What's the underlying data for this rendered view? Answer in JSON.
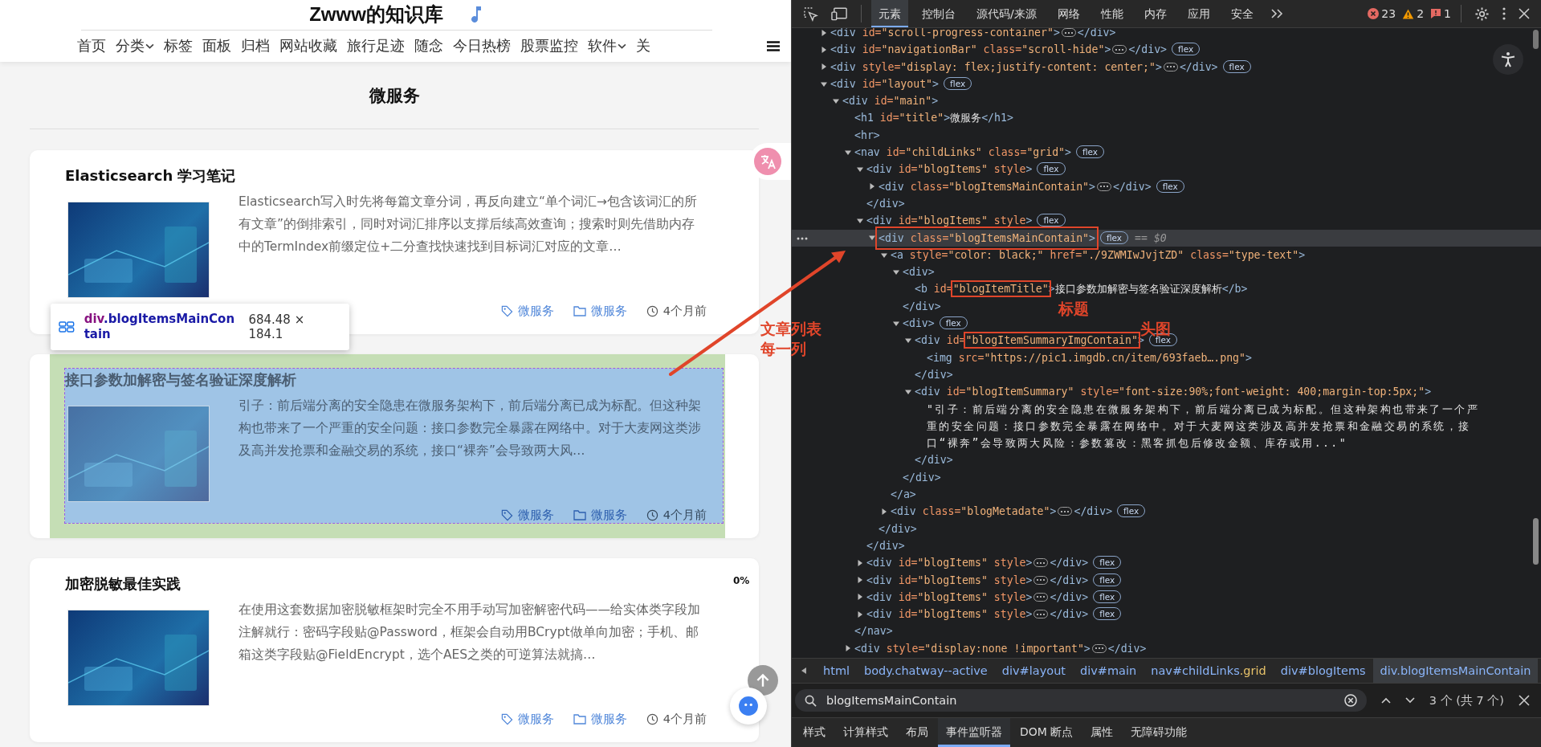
{
  "page": {
    "site_title": "Zwww的知识库",
    "nav": [
      {
        "label": "首页",
        "has_menu": false
      },
      {
        "label": "分类",
        "has_menu": true
      },
      {
        "label": "标签",
        "has_menu": false
      },
      {
        "label": "面板",
        "has_menu": false
      },
      {
        "label": "归档",
        "has_menu": false
      },
      {
        "label": "网站收藏",
        "has_menu": false
      },
      {
        "label": "旅行足迹",
        "has_menu": false
      },
      {
        "label": "随念",
        "has_menu": false
      },
      {
        "label": "今日热榜",
        "has_menu": false
      },
      {
        "label": "股票监控",
        "has_menu": false
      },
      {
        "label": "软件",
        "has_menu": true
      },
      {
        "label": "关",
        "has_menu": false
      }
    ],
    "heading": "微服务",
    "posts": [
      {
        "title": "Elasticsearch 学习笔记",
        "summary": "Elasticsearch写入时先将每篇文章分词，再反向建立“单个词汇→包含该词汇的所有文章”的倒排索引，同时对词汇排序以支撑后续高效查询；搜索时则先借助内存中的TermIndex前缀定位+二分查找快速找到目标词汇对应的文章…",
        "tag": "微服务",
        "category": "微服务",
        "time": "4个月前",
        "inspected": false
      },
      {
        "title": "接口参数加解密与签名验证深度解析",
        "summary": "引子：前后端分离的安全隐患在微服务架构下，前后端分离已成为标配。但这种架构也带来了一个严重的安全问题：接口参数完全暴露在网络中。对于大麦网这类涉及高并发抢票和金融交易的系统，接口“裸奔”会导致两大风…",
        "tag": "微服务",
        "category": "微服务",
        "time": "4个月前",
        "inspected": true
      },
      {
        "title": "加密脱敏最佳实践",
        "summary": "在使用这套数据加密脱敏框架时完全不用手动写加密解密代码——给实体类字段加注解就行：密码字段贴@Password，框架会自动用BCrypt做单向加密；手机、邮箱这类字段贴@FieldEncrypt，选个AES之类的可逆算法就搞…",
        "tag": "微服务",
        "category": "微服务",
        "time": "4个月前",
        "inspected": false
      }
    ],
    "inspect_tooltip": {
      "selector": "div.blogItemsMainContain",
      "size": "684.48 × 184.1"
    },
    "scroll_progress": "0%"
  },
  "devtools": {
    "tabs": [
      {
        "label": "元素",
        "selected": true
      },
      {
        "label": "控制台",
        "selected": false
      },
      {
        "label": "源代码/来源",
        "selected": false
      },
      {
        "label": "网络",
        "selected": false
      },
      {
        "label": "性能",
        "selected": false
      },
      {
        "label": "内存",
        "selected": false
      },
      {
        "label": "应用",
        "selected": false
      },
      {
        "label": "安全",
        "selected": false
      }
    ],
    "errors": "23",
    "warnings": "2",
    "issues": "1",
    "tree": [
      {
        "markup": "<div id=\"scroll-progress-container\">",
        "expanded": false,
        "close": "</div>",
        "selected": false
      },
      {
        "markup": "<div id=\"navigationBar\" class=\"scroll-hide\">",
        "expanded": false,
        "close": "</div>",
        "badge": "flex",
        "selected": false
      },
      {
        "markup": "<div style=\"display: flex;justify-content: center;\">",
        "expanded": false,
        "close": "</div>",
        "badge": "flex",
        "selected": false
      },
      {
        "markup": "<div id=\"layout\">",
        "expanded": true,
        "badge": "flex",
        "selected": false,
        "children": [
          {
            "markup": "<div id=\"main\">",
            "expanded": true,
            "selected": false,
            "children": [
              {
                "markup": "<h1 id=\"title\">微服务</h1>",
                "selected": false
              },
              {
                "markup": "<hr>",
                "selected": false
              },
              {
                "markup": "<nav id=\"childLinks\" class=\"grid\">",
                "expanded": true,
                "badge": "flex",
                "close": "</nav>",
                "selected": false,
                "children": [
                  {
                    "markup": "<div id=\"blogItems\" style>",
                    "expanded": true,
                    "badge": "flex",
                    "close": "</div>",
                    "selected": false,
                    "children": [
                      {
                        "markup": "<div class=\"blogItemsMainContain\">",
                        "expanded": false,
                        "close": "</div>",
                        "badge": "flex",
                        "selected": false
                      }
                    ]
                  },
                  {
                    "markup": "<div id=\"blogItems\" style>",
                    "expanded": true,
                    "badge": "flex",
                    "close": "</div>",
                    "selected": false,
                    "children": [
                      {
                        "markup": "<div class=\"blogItemsMainContain\">",
                        "expanded": true,
                        "badge": "flex",
                        "console_ref": "== $0",
                        "boxed_tag": true,
                        "close": "</div>",
                        "selected": true,
                        "children": [
                          {
                            "markup": "<a style=\"color: black;\" href=\"./9ZWMIwJvjtZD\" class=\"type-text\">",
                            "expanded": true,
                            "close": "</a>",
                            "selected": false,
                            "children": [
                              {
                                "markup": "<div>",
                                "expanded": true,
                                "close": "</div>",
                                "selected": false,
                                "children": [
                                  {
                                    "markup": "<b id=\"blogItemTitle\">接口参数加解密与签名验证深度解析</b>",
                                    "boxed_value": true,
                                    "selected": false
                                  }
                                ]
                              },
                              {
                                "markup": "<div>",
                                "expanded": true,
                                "badge": "flex",
                                "close": "</div>",
                                "selected": false,
                                "children": [
                                  {
                                    "markup": "<div id=\"blogItemSummaryImgContain\">",
                                    "expanded": true,
                                    "badge": "flex",
                                    "boxed_value": true,
                                    "close": "</div>",
                                    "selected": false,
                                    "children": [
                                      {
                                        "markup": "<img src=\"https://pic1.imgdb.cn/item/693faeb….png\">",
                                        "selected": false
                                      }
                                    ]
                                  },
                                  {
                                    "markup": "<div id=\"blogItemSummary\" style=\"font-size:90%;font-weight: 400;margin-top:5px;\">",
                                    "expanded": true,
                                    "close": "</div>",
                                    "selected": false,
                                    "children": [
                                      {
                                        "text": "\"引子：前后端分离的安全隐患在微服务架构下，前后端分离已成为标配。但这种架构也带来了一个严重的安全问题：接口参数完全暴露在网络中。对于大麦网这类涉及高并发抢票和金融交易的系统，接口“裸奔”会导致两大风险：参数篡改：黑客抓包后修改金额、库存或用...\"",
                                        "selected": false
                                      }
                                    ]
                                  }
                                ]
                              }
                            ]
                          },
                          {
                            "markup": "<div class=\"blogMetadate\">",
                            "expanded": false,
                            "badge": "flex",
                            "close": "</div>",
                            "selected": false
                          }
                        ]
                      }
                    ]
                  },
                  {
                    "markup": "<div id=\"blogItems\" style>",
                    "expanded": false,
                    "badge": "flex",
                    "close": "</div>",
                    "selected": false
                  },
                  {
                    "markup": "<div id=\"blogItems\" style>",
                    "expanded": false,
                    "badge": "flex",
                    "close": "</div>",
                    "selected": false
                  },
                  {
                    "markup": "<div id=\"blogItems\" style>",
                    "expanded": false,
                    "badge": "flex",
                    "close": "</div>",
                    "selected": false
                  },
                  {
                    "markup": "<div id=\"blogItems\" style>",
                    "expanded": false,
                    "badge": "flex",
                    "close": "</div>",
                    "selected": false
                  }
                ]
              },
              {
                "markup": "<div style=\"display:none !important\">",
                "expanded": false,
                "close": "</div>",
                "selected": false
              }
            ]
          }
        ]
      }
    ],
    "breadcrumbs": [
      {
        "label": "html",
        "selected": false
      },
      {
        "label": "body.chatway--active",
        "selected": false
      },
      {
        "label": "div#layout",
        "selected": false
      },
      {
        "label": "div#main",
        "selected": false
      },
      {
        "label": "nav#childLinks.grid",
        "selected": false
      },
      {
        "label": "div#blogItems",
        "selected": false
      },
      {
        "label": "div.blogItemsMainContain",
        "selected": true
      }
    ],
    "search": {
      "value": "blogItemsMainContain",
      "match_count": "3 个 (共 7 个)"
    },
    "panel_tabs": [
      {
        "label": "样式",
        "selected": false
      },
      {
        "label": "计算样式",
        "selected": false
      },
      {
        "label": "布局",
        "selected": false
      },
      {
        "label": "事件监听器",
        "selected": true
      },
      {
        "label": "DOM 断点",
        "selected": false
      },
      {
        "label": "属性",
        "selected": false
      },
      {
        "label": "无障碍功能",
        "selected": false
      }
    ]
  },
  "annotations": [
    {
      "text": "文章列表每一列"
    },
    {
      "text": "标题"
    },
    {
      "text": "头图"
    }
  ]
}
